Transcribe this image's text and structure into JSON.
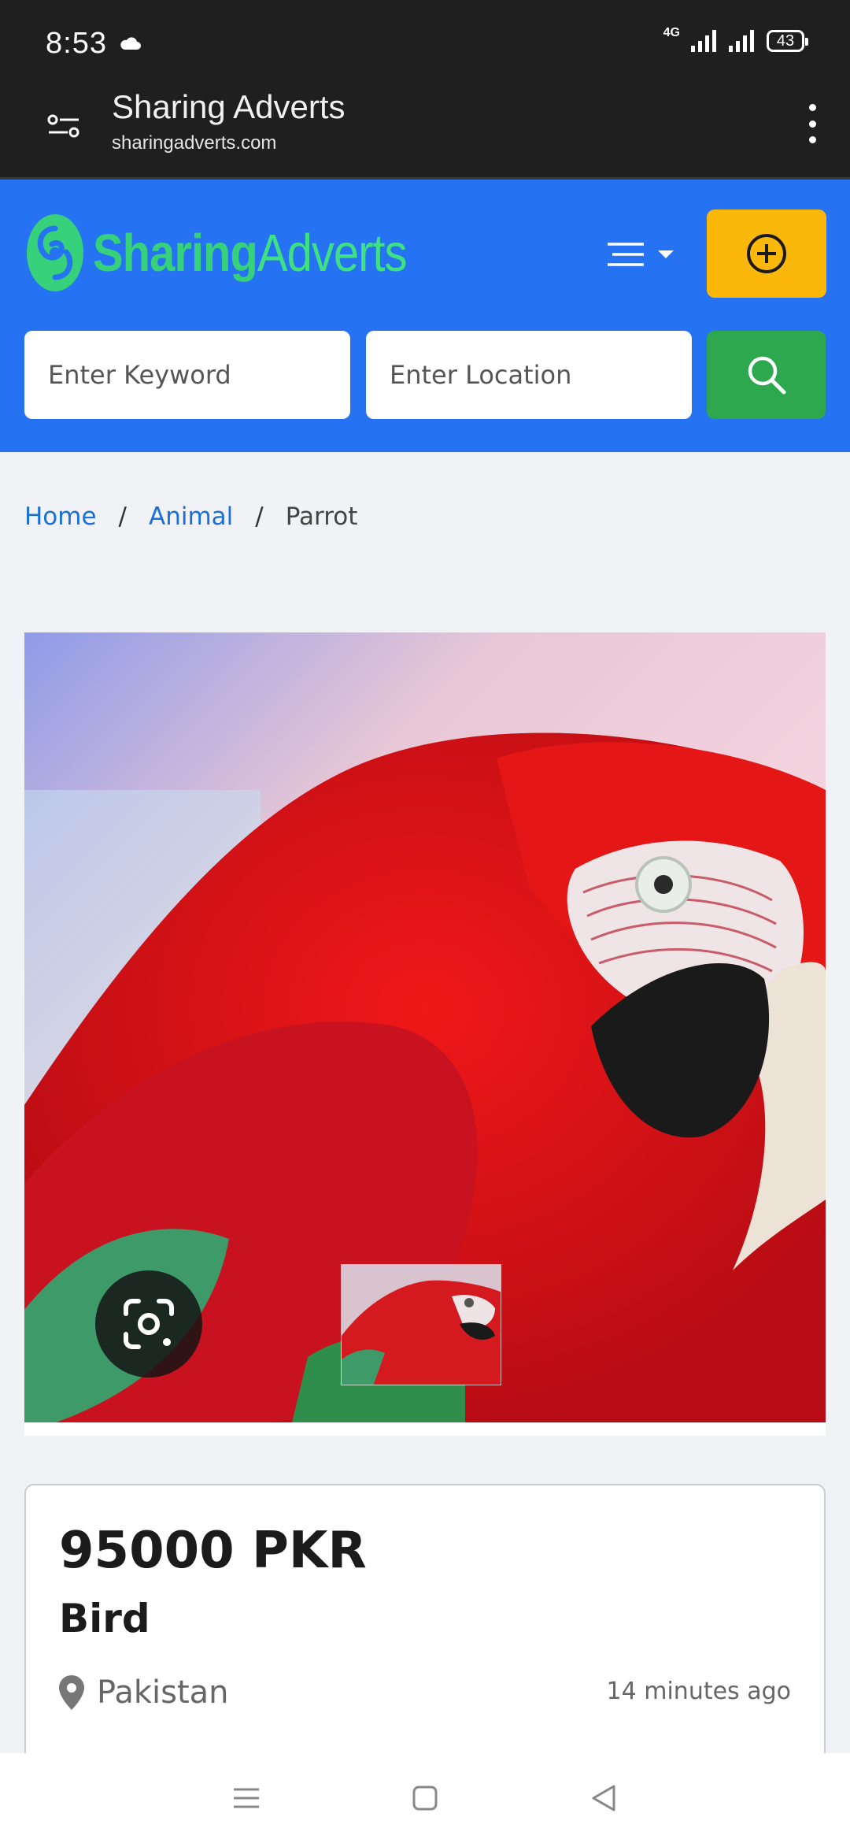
{
  "status_bar": {
    "time": "8:53",
    "network": "4G",
    "battery": "43"
  },
  "browser": {
    "title": "Sharing Adverts",
    "url": "sharingadverts.com"
  },
  "site": {
    "logo_bold": "Sharing",
    "logo_light": "Adverts",
    "keyword_placeholder": "Enter Keyword",
    "location_placeholder": "Enter Location"
  },
  "breadcrumb": {
    "home": "Home",
    "category": "Animal",
    "current": "Parrot",
    "separator": "/"
  },
  "listing": {
    "price": "95000 PKR",
    "title": "Bird",
    "location": "Pakistan",
    "posted": "14 minutes ago"
  },
  "colors": {
    "header_blue": "#2573f2",
    "post_yellow": "#fbb80a",
    "search_green": "#2da84e",
    "logo_green": "#36d17a",
    "link_blue": "#1c6fd9"
  }
}
